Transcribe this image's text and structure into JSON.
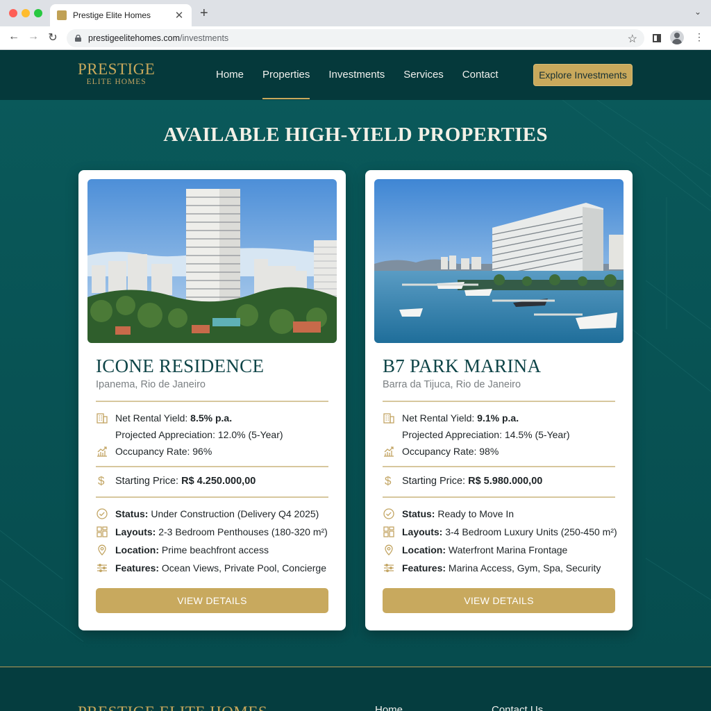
{
  "browser": {
    "tab_title": "Prestige Elite Homes",
    "url_domain": "prestigeelitehomes.com",
    "url_path": "/investments"
  },
  "site": {
    "logo_main": "PRESTIGE",
    "logo_sub": "ELITE HOMES",
    "nav": [
      "Home",
      "Properties",
      "Investments",
      "Services",
      "Contact"
    ],
    "active_nav": "Properties",
    "cta": "Explore Investments",
    "section_title": "AVAILABLE HIGH-YIELD PROPERTIES"
  },
  "properties": [
    {
      "name": "ICONE RESIDENCE",
      "location": "Ipanema, Rio de Janeiro",
      "yield_label": "Net Rental Yield: ",
      "yield_value": "8.5% p.a.",
      "appreciation": "Projected Appreciation: 12.0% (5-Year)",
      "occupancy": "Occupancy Rate: 96%",
      "price_label": "Starting Price: ",
      "price_value": "R$ 4.250.000,00",
      "status_label": "Status:",
      "status_value": " Under Construction (Delivery Q4 2025)",
      "layouts_label": "Layouts:",
      "layouts_value": " 2-3 Bedroom Penthouses (180-320 m²)",
      "location_label": "Location:",
      "location_value": " Prime beachfront access",
      "features_label": "Features:",
      "features_value": " Ocean Views, Private Pool, Concierge",
      "button": "VIEW DETAILS"
    },
    {
      "name": "B7 PARK MARINA",
      "location": "Barra da Tijuca, Rio de Janeiro",
      "yield_label": "Net Rental Yield: ",
      "yield_value": "9.1% p.a.",
      "appreciation": "Projected Appreciation: 14.5% (5-Year)",
      "occupancy": "Occupancy Rate: 98%",
      "price_label": "Starting Price: ",
      "price_value": "R$ 5.980.000,00",
      "status_label": "Status:",
      "status_value": " Ready to Move In",
      "layouts_label": "Layouts:",
      "layouts_value": " 3-4 Bedroom Luxury Units (250-450 m²)",
      "location_label": "Location:",
      "location_value": " Waterfront Marina Frontage",
      "features_label": "Features:",
      "features_value": " Marina Access, Gym, Spa, Security",
      "button": "VIEW DETAILS"
    }
  ],
  "footer": {
    "brand": "PRESTIGE ELITE HOMES",
    "links": [
      "Home",
      "Contact Us"
    ]
  },
  "colors": {
    "teal": "#0a5a5b",
    "header": "#05393b",
    "gold": "#c9a95c"
  }
}
